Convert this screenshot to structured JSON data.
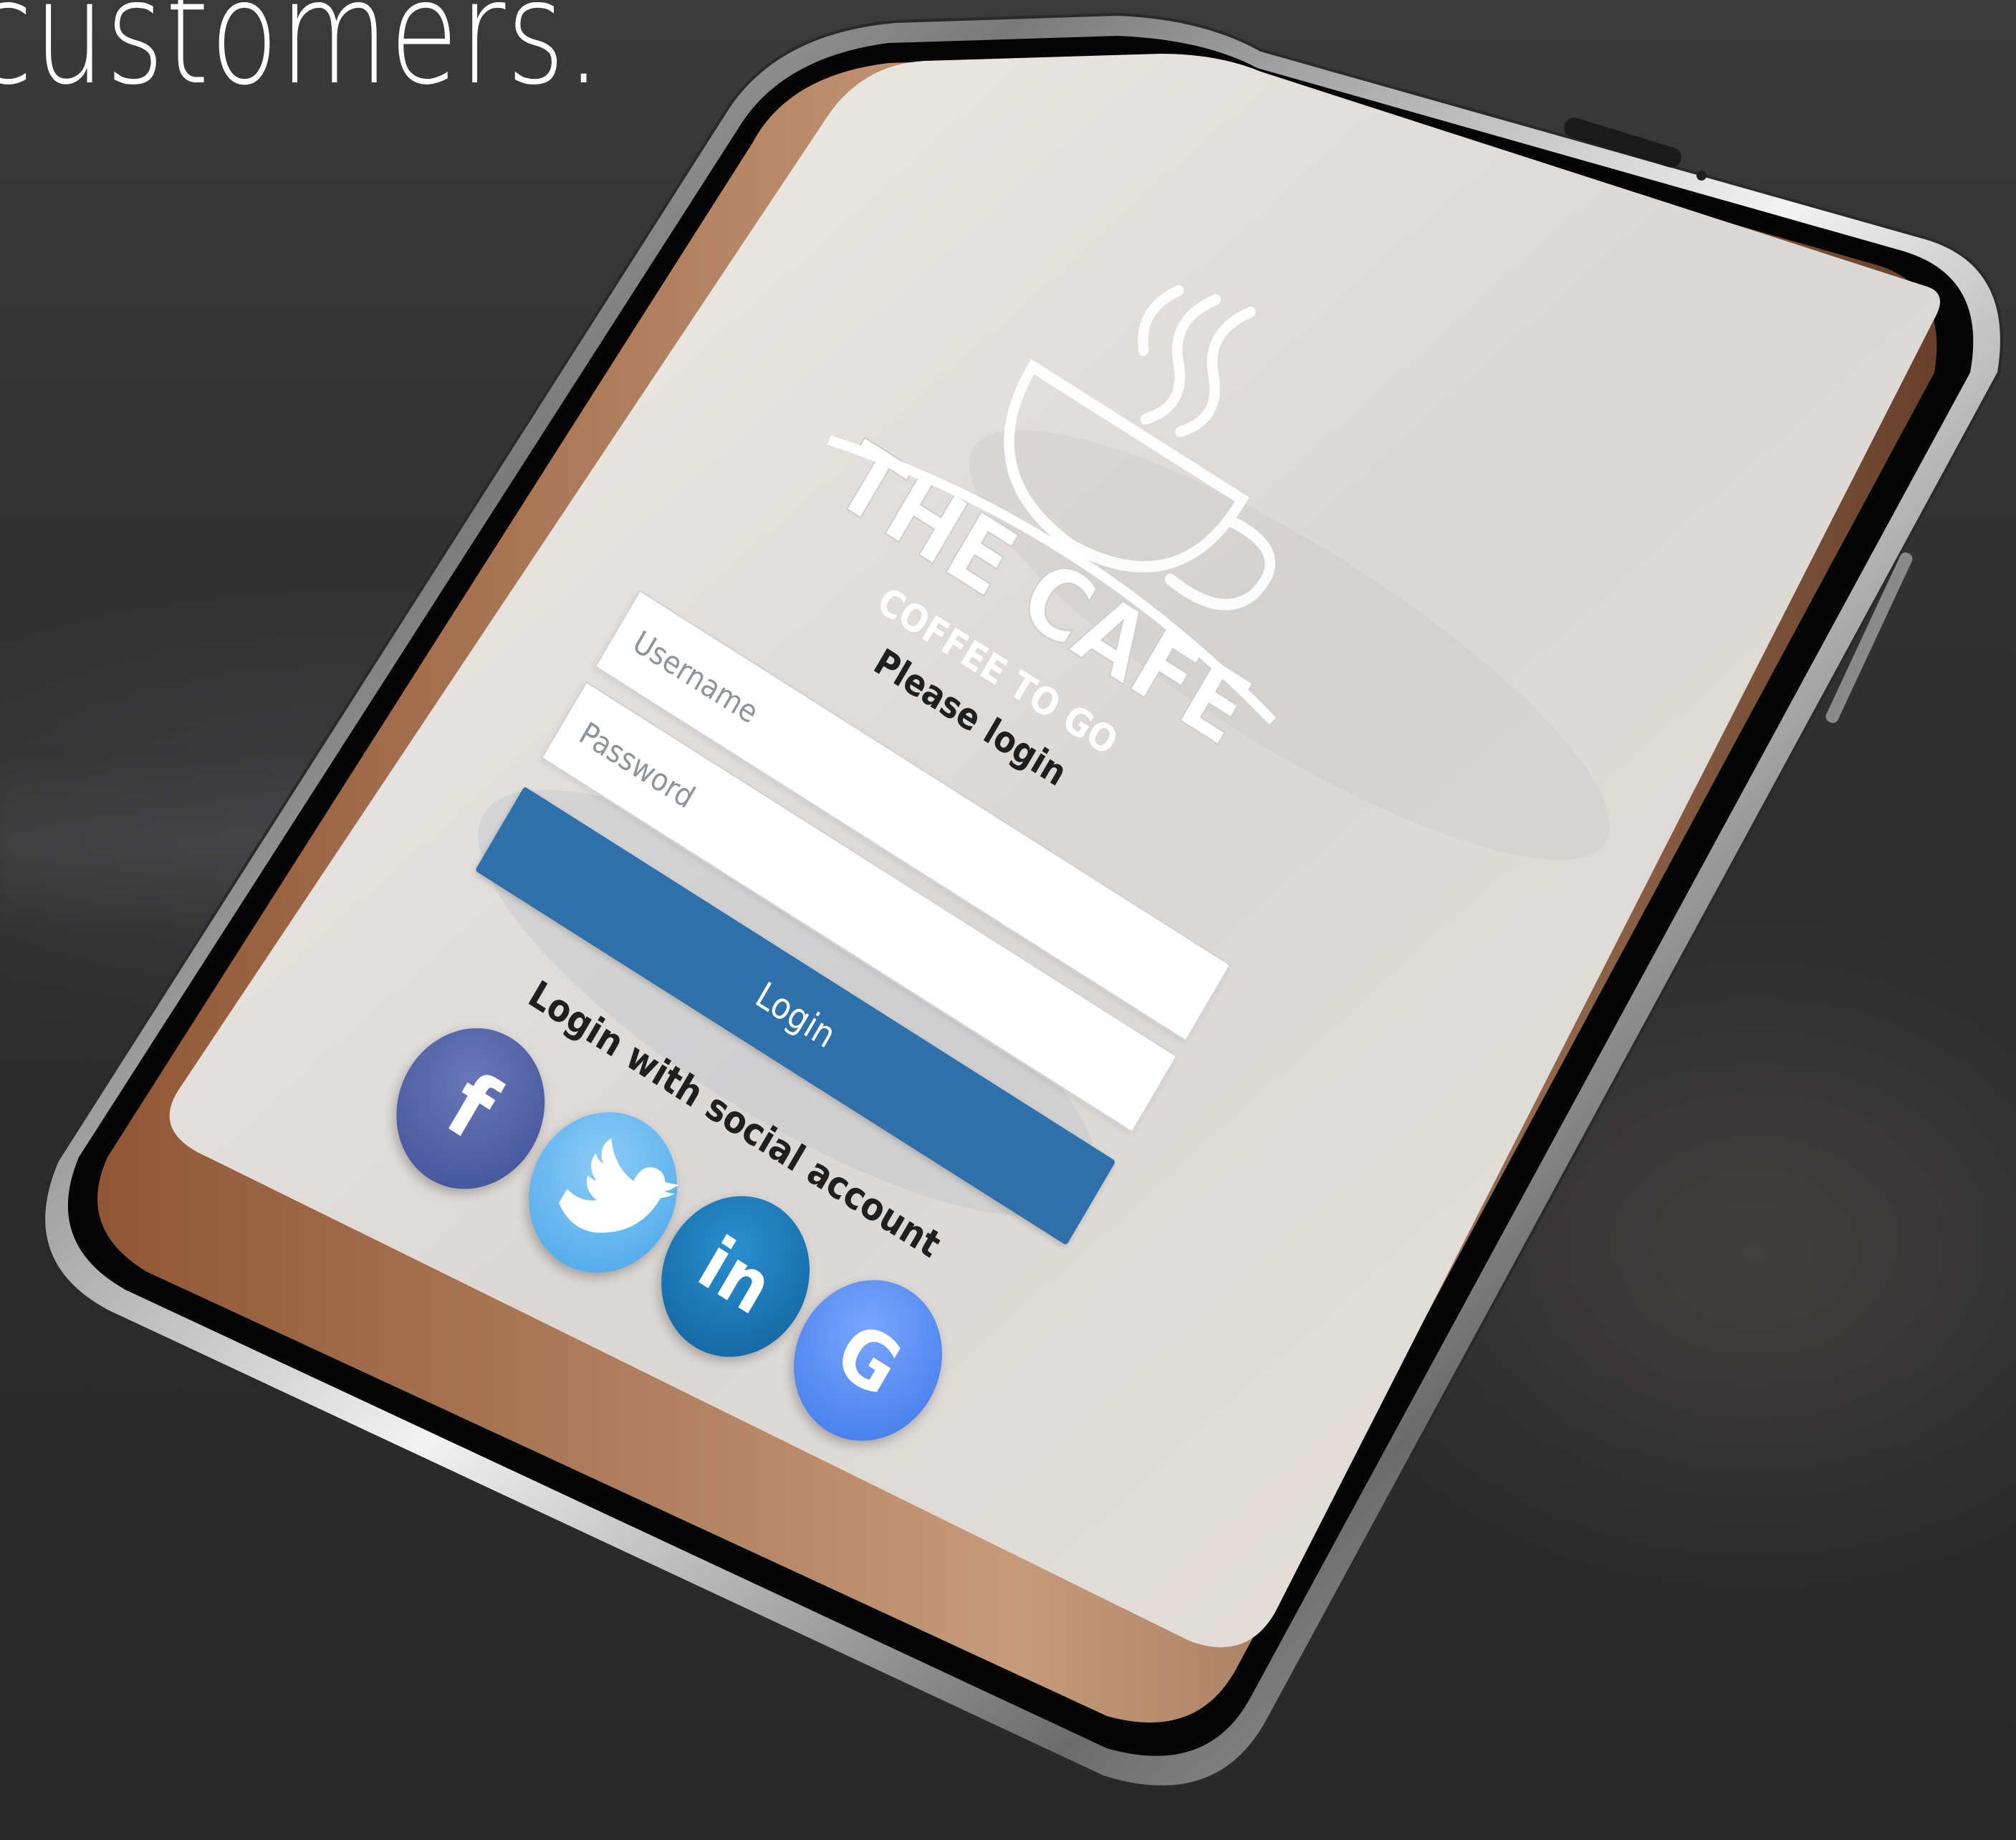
{
  "headline": "customers.",
  "app": {
    "logo": {
      "brand": "THE CAFE",
      "tagline": "COFFEE TO GO"
    },
    "prompt": "Please login",
    "username": {
      "placeholder": "Username"
    },
    "password": {
      "placeholder": "Password"
    },
    "login_button": "Login",
    "social_title": "Login with social account",
    "social_buttons": [
      {
        "network": "Facebook",
        "glyph": "f",
        "icon": "facebook-icon",
        "color": "#4a5aa3"
      },
      {
        "network": "Twitter",
        "glyph": "bird",
        "icon": "twitter-icon",
        "color": "#55acee"
      },
      {
        "network": "LinkedIn",
        "glyph": "in",
        "icon": "linkedin-icon",
        "color": "#1672b3"
      },
      {
        "network": "Google",
        "glyph": "G",
        "icon": "google-icon",
        "color": "#4a86f0"
      }
    ]
  },
  "colors": {
    "background": "#2f2f30",
    "primary_button": "#2f6faa",
    "screen_tint": "#e8e4e1"
  }
}
